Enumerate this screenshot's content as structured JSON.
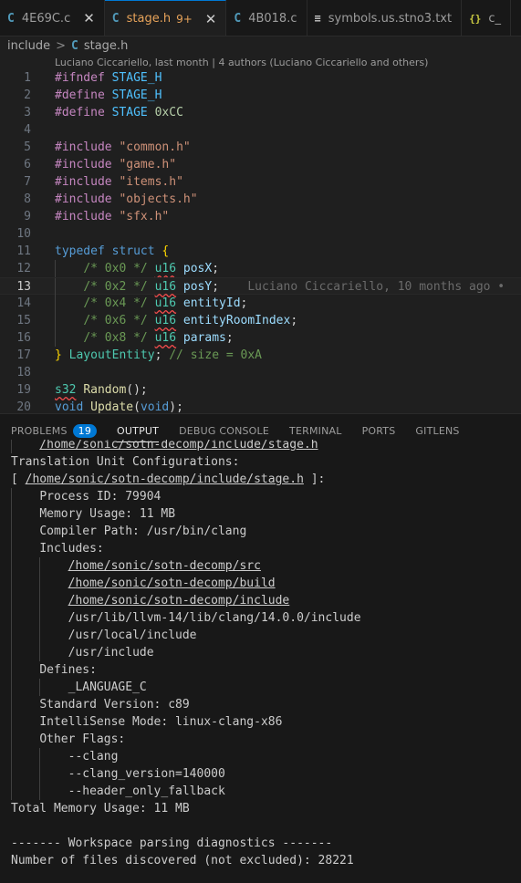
{
  "tabs": [
    {
      "icon": "C",
      "label": "4E69C.c",
      "close": "✕",
      "active": false
    },
    {
      "icon": "C",
      "label": "stage.h",
      "modified": "9+",
      "close": "✕",
      "active": true
    },
    {
      "icon": "C",
      "label": "4B018.c",
      "active": false
    },
    {
      "icon": "≡",
      "label": "symbols.us.stno3.txt",
      "active": false
    },
    {
      "icon": "{}",
      "label": "c_",
      "active": false
    }
  ],
  "breadcrumb": {
    "folder": "include",
    "sep": ">",
    "file_icon": "C",
    "file": "stage.h"
  },
  "blame_header": "Luciano Ciccariello, last month | 4 authors (Luciano Ciccariello and others)",
  "editor": {
    "line_numbers": [
      "1",
      "2",
      "3",
      "4",
      "5",
      "6",
      "7",
      "8",
      "9",
      "10",
      "11",
      "12",
      "13",
      "14",
      "15",
      "16",
      "17",
      "18",
      "19",
      "20"
    ],
    "current_line": "13",
    "tokens": {
      "ifndef": "#ifndef",
      "define": "#define",
      "include": "#include",
      "stage_h": "STAGE_H",
      "stage": "STAGE",
      "hex_cc": "0xCC",
      "common": "\"common.h\"",
      "game": "\"game.h\"",
      "items": "\"items.h\"",
      "objects": "\"objects.h\"",
      "sfx": "\"sfx.h\"",
      "typedef": "typedef",
      "struct": "struct",
      "open_brace": "{",
      "c0": "/* 0x0 */",
      "c2": "/* 0x2 */",
      "c4": "/* 0x4 */",
      "c6": "/* 0x6 */",
      "c8": "/* 0x8 */",
      "u16": "u16",
      "posX": "posX",
      "posY": "posY",
      "entityId": "entityId",
      "entityRoomIndex": "entityRoomIndex",
      "params": "params",
      "semi": ";",
      "close_brace": "}",
      "layout_entity": "LayoutEntity",
      "size_comment": "// size = 0xA",
      "s32": "s32",
      "random": "Random",
      "parens_semi": "();",
      "void": "void",
      "update": "Update",
      "lparen": "(",
      "rparen_semi": ");"
    },
    "inline_blame": "Luciano Ciccariello, 10 months ago •"
  },
  "panel": {
    "tabs": [
      "PROBLEMS",
      "OUTPUT",
      "DEBUG CONSOLE",
      "TERMINAL",
      "PORTS",
      "GITLENS"
    ],
    "problems_count": "19",
    "active_tab": "OUTPUT",
    "output": {
      "l0": "/home/sonic/sotn-decomp/include/stage.h",
      "l1": "Translation Unit Configurations:",
      "l2_open": "[ ",
      "l2_path": "/home/sonic/sotn-decomp/include/stage.h",
      "l2_close": " ]:",
      "l3": "Process ID: 79904",
      "l4": "Memory Usage: 11 MB",
      "l5": "Compiler Path: /usr/bin/clang",
      "l6": "Includes:",
      "l7": "/home/sonic/sotn-decomp/src",
      "l8": "/home/sonic/sotn-decomp/build",
      "l9": "/home/sonic/sotn-decomp/include",
      "l10": "/usr/lib/llvm-14/lib/clang/14.0.0/include",
      "l11": "/usr/local/include",
      "l12": "/usr/include",
      "l13": "Defines:",
      "l14": "_LANGUAGE_C",
      "l15": "Standard Version: c89",
      "l16": "IntelliSense Mode: linux-clang-x86",
      "l17": "Other Flags:",
      "l18": "--clang",
      "l19": "--clang_version=140000",
      "l20": "--header_only_fallback",
      "l21": "Total Memory Usage: 11 MB",
      "l22": "",
      "l23": "------- Workspace parsing diagnostics -------",
      "l24": "Number of files discovered (not excluded): 28221"
    }
  },
  "colors": {
    "accent": "#0078d4",
    "modified": "#e7a35a",
    "squiggle": "#f14c4c"
  }
}
